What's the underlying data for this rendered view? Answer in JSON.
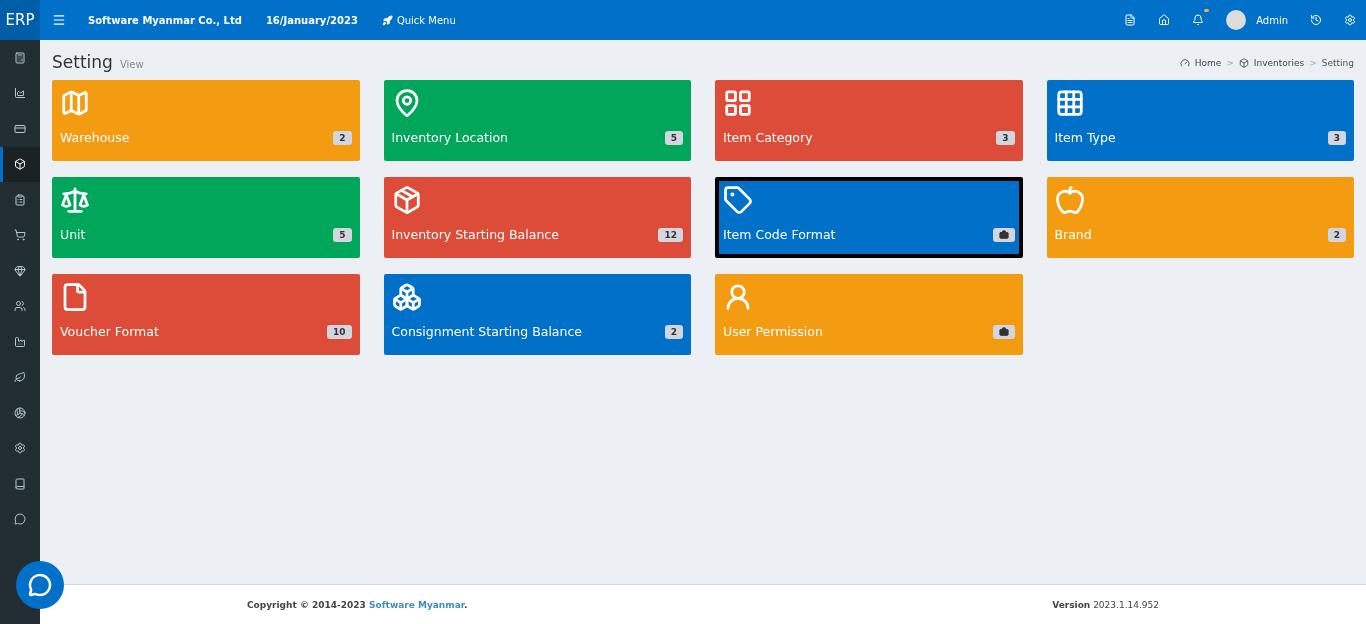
{
  "header": {
    "logo": "ERP",
    "company": "Software Myanmar Co., Ltd",
    "date": "16/January/2023",
    "quick_menu": "Quick Menu",
    "user": "Admin",
    "notification_dot": true
  },
  "sidebar": {
    "items": [
      {
        "selected": false
      },
      {
        "selected": false
      },
      {
        "selected": false
      },
      {
        "selected": true
      },
      {
        "selected": false
      },
      {
        "selected": false
      },
      {
        "selected": false
      },
      {
        "selected": false
      },
      {
        "selected": false
      },
      {
        "selected": false
      },
      {
        "selected": false
      },
      {
        "selected": false
      },
      {
        "selected": false
      },
      {
        "selected": false
      }
    ]
  },
  "page": {
    "title": "Setting",
    "subtitle": "View"
  },
  "breadcrumb": {
    "separator": ">",
    "items": [
      "Home",
      "Inventories",
      "Setting"
    ]
  },
  "tiles": [
    {
      "label": "Warehouse",
      "count": "2",
      "color": "#f39c12",
      "selected": false
    },
    {
      "label": "Inventory Location",
      "count": "5",
      "color": "#00a65a",
      "selected": false
    },
    {
      "label": "Item Category",
      "count": "3",
      "color": "#dd4b39",
      "selected": false
    },
    {
      "label": "Item Type",
      "count": "3",
      "color": "#0070c9",
      "selected": false
    },
    {
      "label": "Unit",
      "count": "5",
      "color": "#00a65a",
      "selected": false
    },
    {
      "label": "Inventory Starting Balance",
      "count": "12",
      "color": "#dd4b39",
      "selected": false
    },
    {
      "label": "Item Code Format",
      "color": "#0070c9",
      "selected": true
    },
    {
      "label": "Brand",
      "count": "2",
      "color": "#f39c12",
      "selected": false
    },
    {
      "label": "Voucher Format",
      "count": "10",
      "color": "#dd4b39",
      "selected": false
    },
    {
      "label": "Consignment Starting Balance",
      "count": "2",
      "color": "#0070c9",
      "selected": false
    },
    {
      "label": "User Permission",
      "color": "#f39c12",
      "selected": false
    }
  ],
  "footer": {
    "copyright": "Copyright © 2014-2023 ",
    "company_link": "Software Myanmar",
    "after_link": ".",
    "version": "**Version** 2023.1.14.952"
  }
}
